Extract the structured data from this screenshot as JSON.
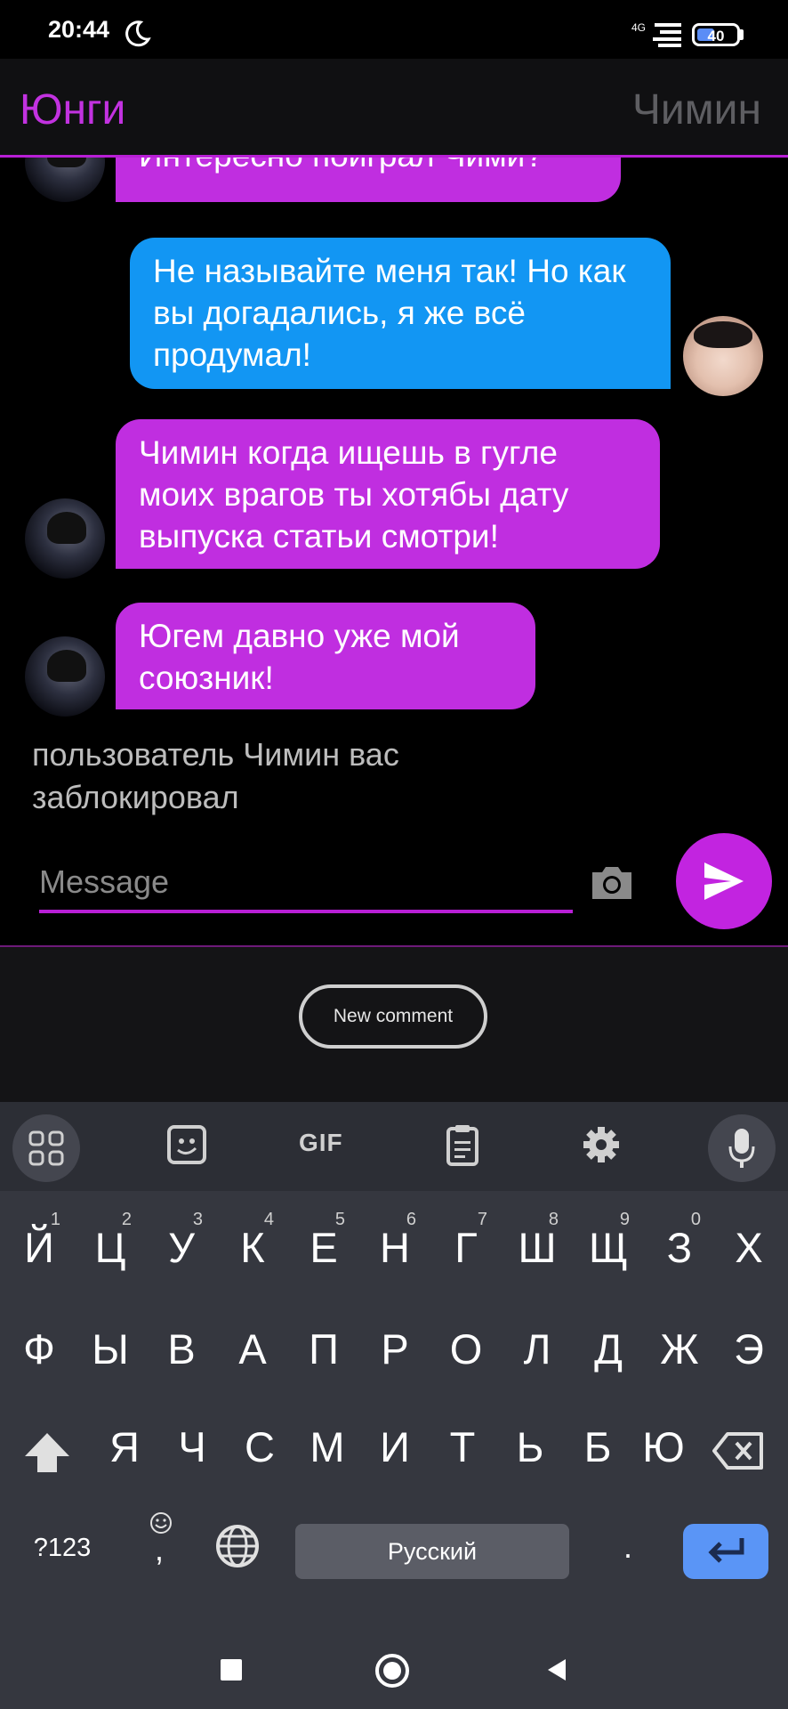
{
  "status_bar": {
    "time": "20:44",
    "network": "4G",
    "battery": "40"
  },
  "header": {
    "left_name": "Юнги",
    "right_name": "Чимин"
  },
  "messages": [
    {
      "text": "Интересно поиграл Чими?",
      "side": "left"
    },
    {
      "text": "Не называйте меня так! Но как вы догадались, я же всё продумал!",
      "side": "right"
    },
    {
      "text": "Чимин когда ищешь в гугле моих врагов ты хотябы дату выпуска статьи смотри!",
      "side": "left"
    },
    {
      "text": "Югем давно уже мой союзник!",
      "side": "left"
    }
  ],
  "blocked_notice": "пользователь Чимин вас заблокировал",
  "composer": {
    "placeholder": "Message"
  },
  "new_comment_label": "New comment",
  "keyboard": {
    "toolbar": [
      "apps-grid-icon",
      "sticker-icon",
      "GIF",
      "clipboard-icon",
      "settings-icon",
      "microphone-icon"
    ],
    "gif_label": "GIF",
    "row1": [
      "Й",
      "Ц",
      "У",
      "К",
      "Е",
      "Н",
      "Г",
      "Ш",
      "Щ",
      "З",
      "Х"
    ],
    "row1_hints": [
      "1",
      "2",
      "3",
      "4",
      "5",
      "6",
      "7",
      "8",
      "9",
      "0"
    ],
    "row2": [
      "Ф",
      "Ы",
      "В",
      "А",
      "П",
      "Р",
      "О",
      "Л",
      "Д",
      "Ж",
      "Э"
    ],
    "row3": [
      "Я",
      "Ч",
      "С",
      "М",
      "И",
      "Т",
      "Ь",
      "Б",
      "Ю"
    ],
    "symbols_label": "?123",
    "comma_label": ",",
    "space_label": "Русский",
    "period_label": "."
  },
  "colors": {
    "accent_purple": "#c02ee0",
    "bubble_blue": "#1296f3",
    "enter_blue": "#5a95f6"
  }
}
